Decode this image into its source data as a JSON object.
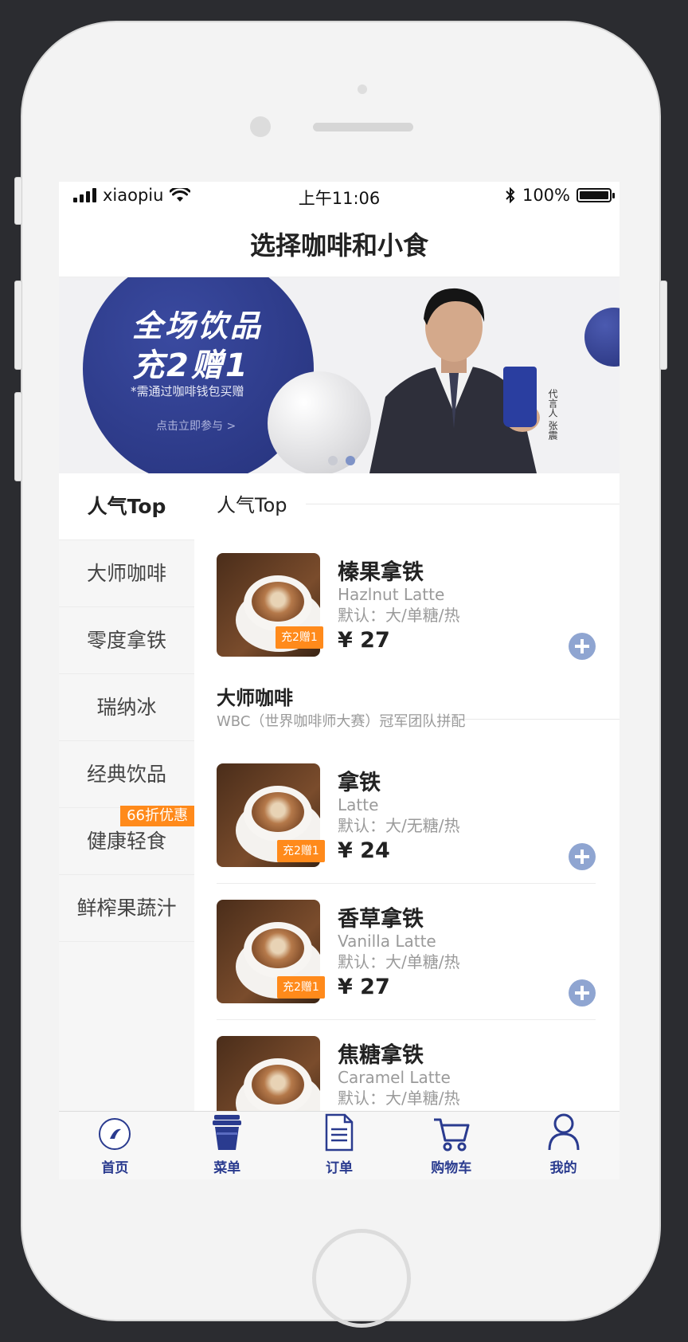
{
  "status_bar": {
    "carrier": "xiaopiu",
    "time": "上午11:06",
    "battery": "100%"
  },
  "header": {
    "title": "选择咖啡和小食"
  },
  "banner": {
    "headline": "全场饮品",
    "promo": "充2赠1",
    "note": "*需通过咖啡钱包买赠",
    "cta": "点击立即参与 >",
    "endorser": "代言人 张震",
    "slide_count": 2,
    "active_slide": 2
  },
  "sidebar": {
    "items": [
      {
        "label": "人气Top",
        "active": true,
        "tag": ""
      },
      {
        "label": "大师咖啡",
        "active": false,
        "tag": ""
      },
      {
        "label": "零度拿铁",
        "active": false,
        "tag": ""
      },
      {
        "label": "瑞纳冰",
        "active": false,
        "tag": ""
      },
      {
        "label": "经典饮品",
        "active": false,
        "tag": ""
      },
      {
        "label": "健康轻食",
        "active": false,
        "tag": "66折优惠"
      },
      {
        "label": "鲜榨果蔬汁",
        "active": false,
        "tag": ""
      }
    ]
  },
  "sections": [
    {
      "title": "人气Top",
      "subtitle": ""
    },
    {
      "title": "大师咖啡",
      "subtitle": "WBC（世界咖啡师大赛）冠军团队拼配"
    }
  ],
  "products": [
    {
      "name": "榛果拿铁",
      "en": "Hazlnut Latte",
      "option": "默认：大/单糖/热",
      "price": "¥ 27",
      "badge": "充2赠1"
    },
    {
      "name": "拿铁",
      "en": "Latte",
      "option": "默认：大/无糖/热",
      "price": "¥ 24",
      "badge": "充2赠1"
    },
    {
      "name": "香草拿铁",
      "en": "Vanilla Latte",
      "option": "默认：大/单糖/热",
      "price": "¥ 27",
      "badge": "充2赠1"
    },
    {
      "name": "焦糖拿铁",
      "en": "Caramel Latte",
      "option": "默认：大/单糖/热",
      "price": "",
      "badge": ""
    }
  ],
  "tabbar": {
    "items": [
      {
        "label": "首页",
        "icon": "home-cup-icon"
      },
      {
        "label": "菜单",
        "icon": "menu-cup-icon"
      },
      {
        "label": "订单",
        "icon": "order-document-icon"
      },
      {
        "label": "购物车",
        "icon": "shopping-cart-icon"
      },
      {
        "label": "我的",
        "icon": "user-profile-icon"
      }
    ]
  },
  "colors": {
    "brand_blue": "#2a3b8f",
    "promo_orange": "#ff8a1b",
    "add_button": "#8fa5d1"
  }
}
